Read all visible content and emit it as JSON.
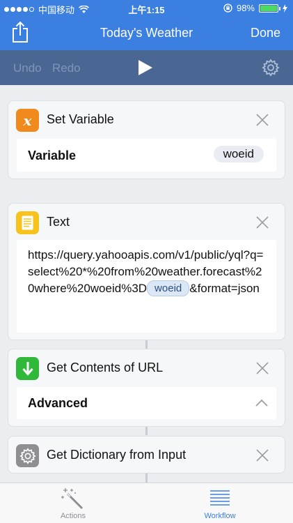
{
  "status_bar": {
    "carrier": "中国移动",
    "time": "上午1:15",
    "battery_percent": "98%",
    "battery_level": 0.98
  },
  "nav": {
    "title": "Today's Weather",
    "done_label": "Done",
    "share_icon": "share-icon"
  },
  "toolbar": {
    "undo_label": "Undo",
    "redo_label": "Redo",
    "play_icon": "play-icon",
    "settings_icon": "gear-icon"
  },
  "actions": [
    {
      "title": "Set Variable",
      "icon": "variable-icon",
      "icon_color": "#f08a1c",
      "field_label": "Variable",
      "field_value": "woeid"
    },
    {
      "title": "Text",
      "icon": "document-icon",
      "icon_color": "#f7c21b",
      "text_before_token": "https://query.yahooapis.com/v1/public/yql?q=select%20*%20from%20weather.forecast%20where%20woeid%3D",
      "token": "woeid",
      "text_after_token": "&format=json"
    },
    {
      "title": "Get Contents of URL",
      "icon": "download-icon",
      "icon_color": "#2fb83a",
      "field_label": "Advanced",
      "expander_icon": "chevron-up-icon"
    },
    {
      "title": "Get Dictionary from Input",
      "icon": "gear-icon",
      "icon_color": "#8e8e93"
    }
  ],
  "tabs": [
    {
      "label": "Actions",
      "icon": "magic-wand-icon",
      "active": false
    },
    {
      "label": "Workflow",
      "icon": "list-icon",
      "active": true
    }
  ],
  "colors": {
    "nav_blue": "#3b7fe0",
    "toolbar_blue": "#4a6793",
    "tab_active": "#3b7fe0",
    "tab_inactive": "#8e8e93"
  }
}
